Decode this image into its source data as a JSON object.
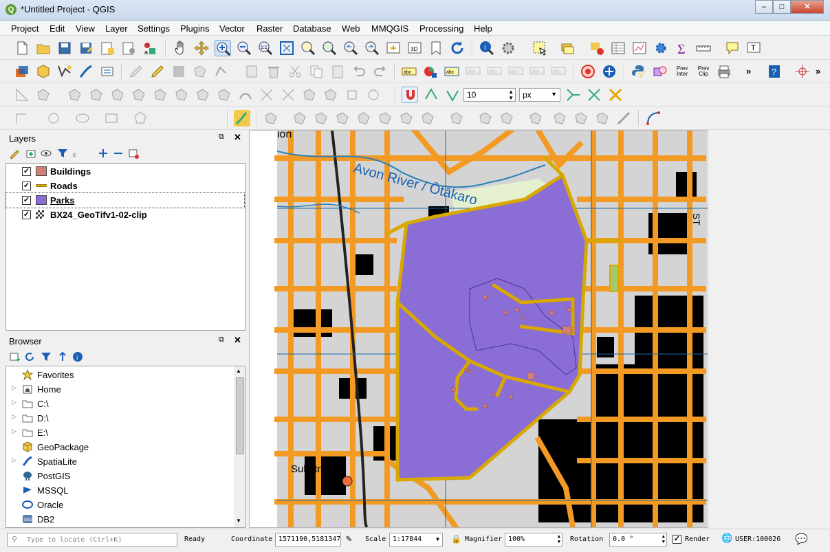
{
  "window": {
    "title": "*Untitled Project - QGIS"
  },
  "menu": [
    "Project",
    "Edit",
    "View",
    "Layer",
    "Settings",
    "Plugins",
    "Vector",
    "Raster",
    "Database",
    "Web",
    "MMQGIS",
    "Processing",
    "Help"
  ],
  "toolbar": {
    "snap_tolerance": "10",
    "snap_unit": "px",
    "prev_inter_label": "Prev Inter",
    "prev_clip_label": "Prev Clip"
  },
  "layers_panel": {
    "title": "Layers",
    "items": [
      {
        "name": "Buildings",
        "checked": true,
        "swatch": "#d4807a"
      },
      {
        "name": "Roads",
        "checked": true,
        "swatch": "#e0b000"
      },
      {
        "name": "Parks",
        "checked": true,
        "swatch": "#8a6ed6",
        "selected": true
      },
      {
        "name": "BX24_GeoTifv1-02-clip",
        "checked": true,
        "swatch": "raster"
      }
    ]
  },
  "browser_panel": {
    "title": "Browser",
    "items": [
      {
        "label": "Favorites",
        "icon": "star-icon",
        "expandable": false
      },
      {
        "label": "Home",
        "icon": "home-folder-icon",
        "expandable": true
      },
      {
        "label": "C:\\",
        "icon": "folder-icon",
        "expandable": true
      },
      {
        "label": "D:\\",
        "icon": "folder-icon",
        "expandable": true
      },
      {
        "label": "E:\\",
        "icon": "folder-icon",
        "expandable": true
      },
      {
        "label": "GeoPackage",
        "icon": "geopackage-icon",
        "expandable": false
      },
      {
        "label": "SpatiaLite",
        "icon": "spatialite-icon",
        "expandable": true
      },
      {
        "label": "PostGIS",
        "icon": "postgis-icon",
        "expandable": false
      },
      {
        "label": "MSSQL",
        "icon": "mssql-icon",
        "expandable": false
      },
      {
        "label": "Oracle",
        "icon": "oracle-icon",
        "expandable": false
      },
      {
        "label": "DB2",
        "icon": "db2-icon",
        "expandable": false
      }
    ]
  },
  "map": {
    "labels": {
      "river": "Avon River / Ōtākaro",
      "substation": "Substn",
      "street_fragment": "ST",
      "top_fragment": "ion"
    }
  },
  "statusbar": {
    "locate_placeholder": "Type to locate (Ctrl+K)",
    "ready": "Ready",
    "coordinate_label": "Coordinate",
    "coordinate_value": "1571190,5181347",
    "scale_label": "Scale",
    "scale_value": "1:17844",
    "magnifier_label": "Magnifier",
    "magnifier_value": "100%",
    "rotation_label": "Rotation",
    "rotation_value": "0.0 °",
    "render_label": "Render",
    "crs": "USER:100026"
  }
}
